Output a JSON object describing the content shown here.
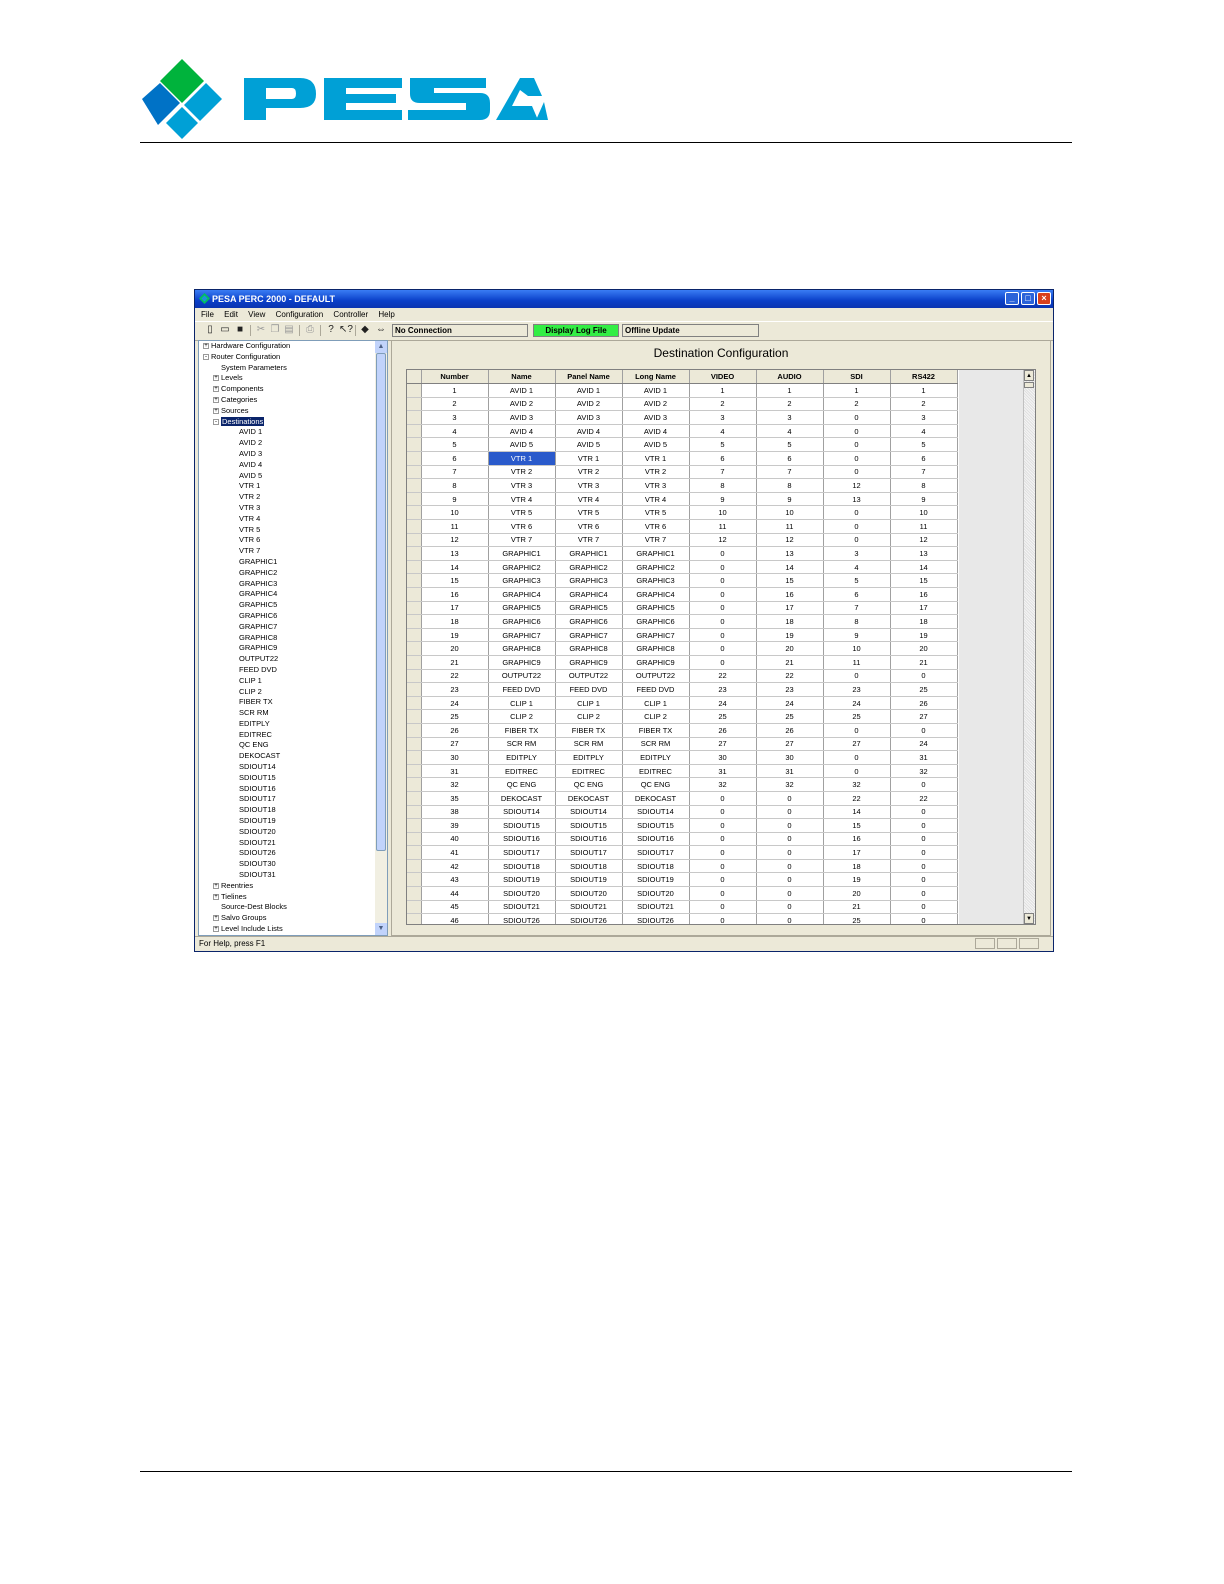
{
  "brand": {
    "name": "PESA",
    "colors": {
      "teal": "#00a0d6",
      "green": "#00b33c",
      "blue": "#0072c6"
    }
  },
  "window": {
    "title": "PESA PERC 2000 - DEFAULT",
    "controls": [
      "minimize-icon",
      "maximize-icon",
      "close-icon"
    ]
  },
  "menu": [
    "File",
    "Edit",
    "View",
    "Configuration",
    "Controller",
    "Help"
  ],
  "toolbar": {
    "connection_status": "No Connection",
    "display_log_label": "Display Log File",
    "offline_label": "Offline Update"
  },
  "tree": [
    {
      "label": "Hardware Configuration",
      "level": 0,
      "exp": "+"
    },
    {
      "label": "Router Configuration",
      "level": 0,
      "exp": "-"
    },
    {
      "label": "System Parameters",
      "level": 1,
      "exp": ""
    },
    {
      "label": "Levels",
      "level": 1,
      "exp": "+"
    },
    {
      "label": "Components",
      "level": 1,
      "exp": "+"
    },
    {
      "label": "Categories",
      "level": 1,
      "exp": "+"
    },
    {
      "label": "Sources",
      "level": 1,
      "exp": "+"
    },
    {
      "label": "Destinations",
      "level": 1,
      "exp": "-",
      "selected": true
    },
    {
      "label": "AVID 1",
      "level": 2
    },
    {
      "label": "AVID 2",
      "level": 2
    },
    {
      "label": "AVID 3",
      "level": 2
    },
    {
      "label": "AVID 4",
      "level": 2
    },
    {
      "label": "AVID 5",
      "level": 2
    },
    {
      "label": "VTR 1",
      "level": 2
    },
    {
      "label": "VTR 2",
      "level": 2
    },
    {
      "label": "VTR 3",
      "level": 2
    },
    {
      "label": "VTR 4",
      "level": 2
    },
    {
      "label": "VTR 5",
      "level": 2
    },
    {
      "label": "VTR 6",
      "level": 2
    },
    {
      "label": "VTR 7",
      "level": 2
    },
    {
      "label": "GRAPHIC1",
      "level": 2
    },
    {
      "label": "GRAPHIC2",
      "level": 2
    },
    {
      "label": "GRAPHIC3",
      "level": 2
    },
    {
      "label": "GRAPHIC4",
      "level": 2
    },
    {
      "label": "GRAPHIC5",
      "level": 2
    },
    {
      "label": "GRAPHIC6",
      "level": 2
    },
    {
      "label": "GRAPHIC7",
      "level": 2
    },
    {
      "label": "GRAPHIC8",
      "level": 2
    },
    {
      "label": "GRAPHIC9",
      "level": 2
    },
    {
      "label": "OUTPUT22",
      "level": 2
    },
    {
      "label": "FEED DVD",
      "level": 2
    },
    {
      "label": "CLIP 1",
      "level": 2
    },
    {
      "label": "CLIP 2",
      "level": 2
    },
    {
      "label": "FIBER TX",
      "level": 2
    },
    {
      "label": "SCR RM",
      "level": 2
    },
    {
      "label": "EDITPLY",
      "level": 2
    },
    {
      "label": "EDITREC",
      "level": 2
    },
    {
      "label": "QC ENG",
      "level": 2
    },
    {
      "label": "DEKOCAST",
      "level": 2
    },
    {
      "label": "SDIOUT14",
      "level": 2
    },
    {
      "label": "SDIOUT15",
      "level": 2
    },
    {
      "label": "SDIOUT16",
      "level": 2
    },
    {
      "label": "SDIOUT17",
      "level": 2
    },
    {
      "label": "SDIOUT18",
      "level": 2
    },
    {
      "label": "SDIOUT19",
      "level": 2
    },
    {
      "label": "SDIOUT20",
      "level": 2
    },
    {
      "label": "SDIOUT21",
      "level": 2
    },
    {
      "label": "SDIOUT26",
      "level": 2
    },
    {
      "label": "SDIOUT30",
      "level": 2
    },
    {
      "label": "SDIOUT31",
      "level": 2
    },
    {
      "label": "Reentries",
      "level": 1,
      "exp": "+"
    },
    {
      "label": "Tielines",
      "level": 1,
      "exp": "+"
    },
    {
      "label": "Source-Dest Blocks",
      "level": 1,
      "exp": ""
    },
    {
      "label": "Salvo Groups",
      "level": 1,
      "exp": "+"
    },
    {
      "label": "Level Include Lists",
      "level": 1,
      "exp": "+"
    }
  ],
  "panel_title": "Destination Configuration",
  "table": {
    "columns": [
      "Number",
      "Name",
      "Panel Name",
      "Long Name",
      "VIDEO",
      "AUDIO",
      "SDI",
      "RS422"
    ],
    "selected": {
      "row": 5,
      "col": 1
    },
    "rows": [
      [
        "1",
        "AVID 1",
        "AVID 1",
        "AVID 1",
        "1",
        "1",
        "1",
        "1"
      ],
      [
        "2",
        "AVID 2",
        "AVID 2",
        "AVID 2",
        "2",
        "2",
        "2",
        "2"
      ],
      [
        "3",
        "AVID 3",
        "AVID 3",
        "AVID 3",
        "3",
        "3",
        "0",
        "3"
      ],
      [
        "4",
        "AVID 4",
        "AVID 4",
        "AVID 4",
        "4",
        "4",
        "0",
        "4"
      ],
      [
        "5",
        "AVID 5",
        "AVID 5",
        "AVID 5",
        "5",
        "5",
        "0",
        "5"
      ],
      [
        "6",
        "VTR 1",
        "VTR 1",
        "VTR 1",
        "6",
        "6",
        "0",
        "6"
      ],
      [
        "7",
        "VTR 2",
        "VTR 2",
        "VTR 2",
        "7",
        "7",
        "0",
        "7"
      ],
      [
        "8",
        "VTR 3",
        "VTR 3",
        "VTR 3",
        "8",
        "8",
        "12",
        "8"
      ],
      [
        "9",
        "VTR 4",
        "VTR 4",
        "VTR 4",
        "9",
        "9",
        "13",
        "9"
      ],
      [
        "10",
        "VTR 5",
        "VTR 5",
        "VTR 5",
        "10",
        "10",
        "0",
        "10"
      ],
      [
        "11",
        "VTR 6",
        "VTR 6",
        "VTR 6",
        "11",
        "11",
        "0",
        "11"
      ],
      [
        "12",
        "VTR 7",
        "VTR 7",
        "VTR 7",
        "12",
        "12",
        "0",
        "12"
      ],
      [
        "13",
        "GRAPHIC1",
        "GRAPHIC1",
        "GRAPHIC1",
        "0",
        "13",
        "3",
        "13"
      ],
      [
        "14",
        "GRAPHIC2",
        "GRAPHIC2",
        "GRAPHIC2",
        "0",
        "14",
        "4",
        "14"
      ],
      [
        "15",
        "GRAPHIC3",
        "GRAPHIC3",
        "GRAPHIC3",
        "0",
        "15",
        "5",
        "15"
      ],
      [
        "16",
        "GRAPHIC4",
        "GRAPHIC4",
        "GRAPHIC4",
        "0",
        "16",
        "6",
        "16"
      ],
      [
        "17",
        "GRAPHIC5",
        "GRAPHIC5",
        "GRAPHIC5",
        "0",
        "17",
        "7",
        "17"
      ],
      [
        "18",
        "GRAPHIC6",
        "GRAPHIC6",
        "GRAPHIC6",
        "0",
        "18",
        "8",
        "18"
      ],
      [
        "19",
        "GRAPHIC7",
        "GRAPHIC7",
        "GRAPHIC7",
        "0",
        "19",
        "9",
        "19"
      ],
      [
        "20",
        "GRAPHIC8",
        "GRAPHIC8",
        "GRAPHIC8",
        "0",
        "20",
        "10",
        "20"
      ],
      [
        "21",
        "GRAPHIC9",
        "GRAPHIC9",
        "GRAPHIC9",
        "0",
        "21",
        "11",
        "21"
      ],
      [
        "22",
        "OUTPUT22",
        "OUTPUT22",
        "OUTPUT22",
        "22",
        "22",
        "0",
        "0"
      ],
      [
        "23",
        "FEED DVD",
        "FEED DVD",
        "FEED DVD",
        "23",
        "23",
        "23",
        "25"
      ],
      [
        "24",
        "CLIP 1",
        "CLIP 1",
        "CLIP 1",
        "24",
        "24",
        "24",
        "26"
      ],
      [
        "25",
        "CLIP 2",
        "CLIP 2",
        "CLIP 2",
        "25",
        "25",
        "25",
        "27"
      ],
      [
        "26",
        "FIBER TX",
        "FIBER TX",
        "FIBER TX",
        "26",
        "26",
        "0",
        "0"
      ],
      [
        "27",
        "SCR RM",
        "SCR RM",
        "SCR RM",
        "27",
        "27",
        "27",
        "24"
      ],
      [
        "30",
        "EDITPLY",
        "EDITPLY",
        "EDITPLY",
        "30",
        "30",
        "0",
        "31"
      ],
      [
        "31",
        "EDITREC",
        "EDITREC",
        "EDITREC",
        "31",
        "31",
        "0",
        "32"
      ],
      [
        "32",
        "QC ENG",
        "QC ENG",
        "QC ENG",
        "32",
        "32",
        "32",
        "0"
      ],
      [
        "35",
        "DEKOCAST",
        "DEKOCAST",
        "DEKOCAST",
        "0",
        "0",
        "22",
        "22"
      ],
      [
        "38",
        "SDIOUT14",
        "SDIOUT14",
        "SDIOUT14",
        "0",
        "0",
        "14",
        "0"
      ],
      [
        "39",
        "SDIOUT15",
        "SDIOUT15",
        "SDIOUT15",
        "0",
        "0",
        "15",
        "0"
      ],
      [
        "40",
        "SDIOUT16",
        "SDIOUT16",
        "SDIOUT16",
        "0",
        "0",
        "16",
        "0"
      ],
      [
        "41",
        "SDIOUT17",
        "SDIOUT17",
        "SDIOUT17",
        "0",
        "0",
        "17",
        "0"
      ],
      [
        "42",
        "SDIOUT18",
        "SDIOUT18",
        "SDIOUT18",
        "0",
        "0",
        "18",
        "0"
      ],
      [
        "43",
        "SDIOUT19",
        "SDIOUT19",
        "SDIOUT19",
        "0",
        "0",
        "19",
        "0"
      ],
      [
        "44",
        "SDIOUT20",
        "SDIOUT20",
        "SDIOUT20",
        "0",
        "0",
        "20",
        "0"
      ],
      [
        "45",
        "SDIOUT21",
        "SDIOUT21",
        "SDIOUT21",
        "0",
        "0",
        "21",
        "0"
      ],
      [
        "46",
        "SDIOUT26",
        "SDIOUT26",
        "SDIOUT26",
        "0",
        "0",
        "25",
        "0"
      ]
    ]
  },
  "statusbar": {
    "help_text": "For Help, press F1"
  }
}
